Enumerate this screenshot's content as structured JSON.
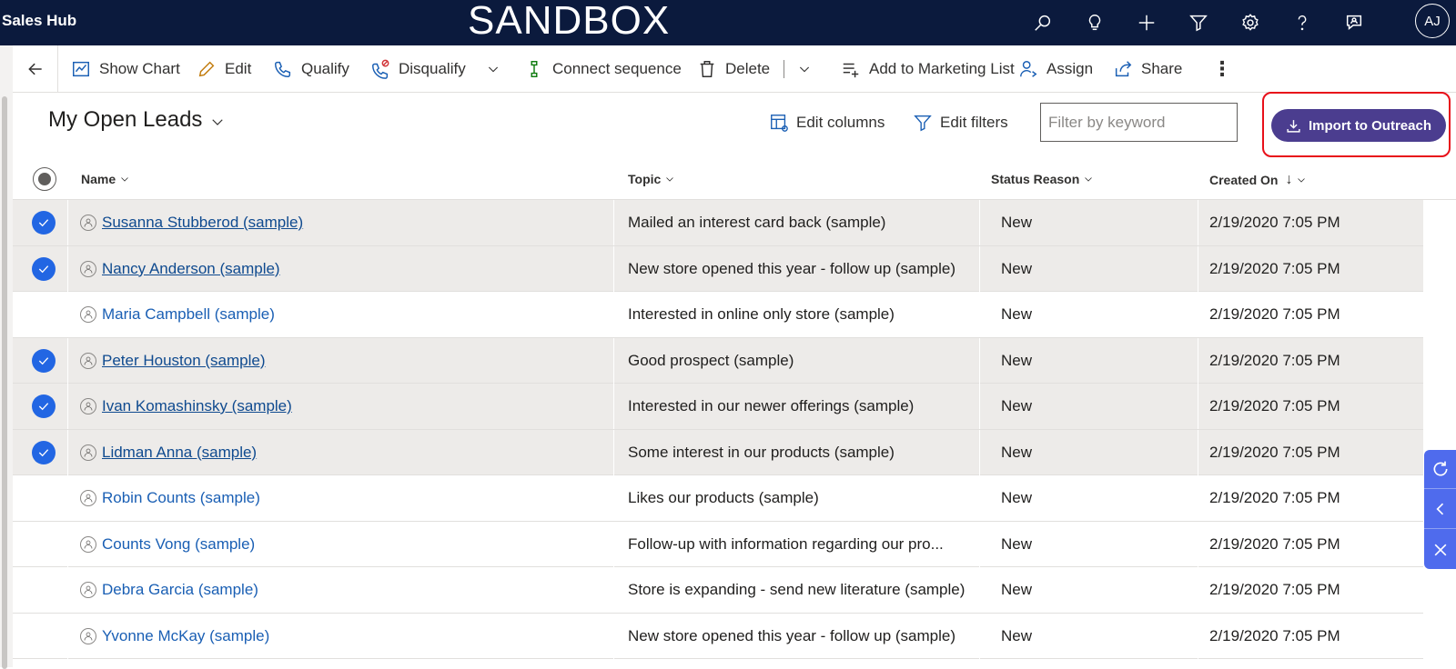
{
  "topbar": {
    "app_title": "Sales Hub",
    "environment": "SANDBOX",
    "icons": [
      "search-icon",
      "lightbulb-icon",
      "plus-icon",
      "filter-icon",
      "gear-icon",
      "help-icon",
      "chat-icon"
    ],
    "avatar_initials": "AJ"
  },
  "commandbar": {
    "show_chart": "Show Chart",
    "edit": "Edit",
    "qualify": "Qualify",
    "disqualify": "Disqualify",
    "connect_sequence": "Connect sequence",
    "delete": "Delete",
    "add_to_marketing_list": "Add to Marketing List",
    "assign": "Assign",
    "share": "Share"
  },
  "view": {
    "title": "My Open Leads",
    "edit_columns": "Edit columns",
    "edit_filters": "Edit filters",
    "filter_placeholder": "Filter by keyword",
    "import_button": "Import to Outreach"
  },
  "grid": {
    "columns": {
      "name": "Name",
      "topic": "Topic",
      "status_reason": "Status Reason",
      "created_on": "Created On"
    },
    "rows": [
      {
        "selected": true,
        "name": "Susanna Stubberod (sample)",
        "topic": "Mailed an interest card back  (sample)",
        "status": "New",
        "created": "2/19/2020 7:05 PM"
      },
      {
        "selected": true,
        "name": "Nancy Anderson (sample)",
        "topic": "New store opened this year - follow up (sample)",
        "status": "New",
        "created": "2/19/2020 7:05 PM"
      },
      {
        "selected": false,
        "name": "Maria Campbell (sample)",
        "topic": "Interested in online only store (sample)",
        "status": "New",
        "created": "2/19/2020 7:05 PM"
      },
      {
        "selected": true,
        "name": "Peter Houston (sample)",
        "topic": "Good prospect (sample)",
        "status": "New",
        "created": "2/19/2020 7:05 PM"
      },
      {
        "selected": true,
        "name": "Ivan Komashinsky (sample)",
        "topic": "Interested in our newer offerings (sample)",
        "status": "New",
        "created": "2/19/2020 7:05 PM"
      },
      {
        "selected": true,
        "name": "Lidman Anna (sample)",
        "topic": "Some interest in our products (sample)",
        "status": "New",
        "created": "2/19/2020 7:05 PM"
      },
      {
        "selected": false,
        "name": "Robin Counts (sample)",
        "topic": "Likes our products (sample)",
        "status": "New",
        "created": "2/19/2020 7:05 PM"
      },
      {
        "selected": false,
        "name": "Counts Vong (sample)",
        "topic": "Follow-up with information regarding our pro...",
        "status": "New",
        "created": "2/19/2020 7:05 PM"
      },
      {
        "selected": false,
        "name": "Debra Garcia (sample)",
        "topic": "Store is expanding - send new literature (sample)",
        "status": "New",
        "created": "2/19/2020 7:05 PM"
      },
      {
        "selected": false,
        "name": "Yvonne McKay (sample)",
        "topic": "New store opened this year - follow up (sample)",
        "status": "New",
        "created": "2/19/2020 7:05 PM"
      }
    ]
  },
  "sidepanel": {
    "icons": [
      "refresh-icon",
      "chevron-left-icon",
      "close-icon"
    ]
  },
  "colors": {
    "topbar": "#0b1a3d",
    "import_button": "#4b3d8f",
    "highlight": "#e8101a",
    "selected_check": "#2266e3",
    "link": "#1a5fb4",
    "side_panel": "#4f6bed"
  }
}
